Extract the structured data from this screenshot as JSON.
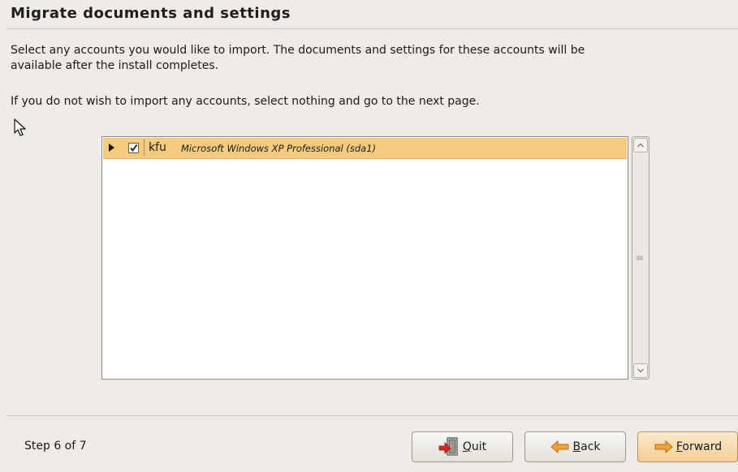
{
  "header": {
    "title": "Migrate documents and settings"
  },
  "body": {
    "instructions": "Select any accounts you would like to import.  The documents and settings for these accounts will be available after the install completes.",
    "skip_note": "If you do not wish to import any accounts, select nothing and go to the next page."
  },
  "accounts": [
    {
      "username": "kfu",
      "os": "Microsoft Windows XP Professional (sda1)",
      "checked": true,
      "expanded": false,
      "selected": true
    }
  ],
  "footer": {
    "step_label": "Step 6 of 7",
    "buttons": {
      "quit": {
        "mnemonic": "Q",
        "rest": "uit",
        "icon": "quit-door-icon"
      },
      "back": {
        "mnemonic": "B",
        "rest": "ack",
        "icon": "arrow-left-icon"
      },
      "forward": {
        "mnemonic": "F",
        "rest": "orward",
        "icon": "arrow-right-icon"
      }
    }
  },
  "colors": {
    "background": "#efebe7",
    "row_highlight": "#f6cb80",
    "arrow_orange": "#f0a23c",
    "forward_button": "#f4cf98"
  }
}
